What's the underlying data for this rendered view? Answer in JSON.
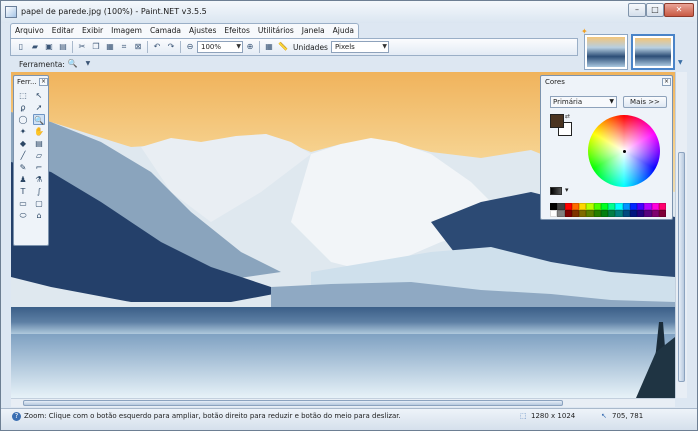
{
  "window": {
    "title": "papel de parede.jpg (100%) - Paint.NET v3.5.5"
  },
  "menu": {
    "items": [
      "Arquivo",
      "Editar",
      "Exibir",
      "Imagem",
      "Camada",
      "Ajustes",
      "Efeitos",
      "Utilitários",
      "Janela",
      "Ajuda"
    ]
  },
  "toolbar": {
    "zoom_value": "100%",
    "units_label": "Unidades",
    "units_value": "Pixels",
    "tool_label": "Ferramenta:"
  },
  "tools_panel": {
    "title": "Ferr...",
    "close": "×",
    "tools": [
      {
        "name": "rectangle-select-icon",
        "glyph": "⬚"
      },
      {
        "name": "move-selection-icon",
        "glyph": "↖"
      },
      {
        "name": "lasso-select-icon",
        "glyph": "ϼ"
      },
      {
        "name": "move-selected-icon",
        "glyph": "➚"
      },
      {
        "name": "ellipse-select-icon",
        "glyph": "◯"
      },
      {
        "name": "zoom-icon",
        "glyph": "🔍",
        "active": true
      },
      {
        "name": "magic-wand-icon",
        "glyph": "✦"
      },
      {
        "name": "pan-icon",
        "glyph": "✋"
      },
      {
        "name": "paint-bucket-icon",
        "glyph": "◆"
      },
      {
        "name": "gradient-icon",
        "glyph": "▤"
      },
      {
        "name": "paintbrush-icon",
        "glyph": "╱"
      },
      {
        "name": "eraser-icon",
        "glyph": "▱"
      },
      {
        "name": "pencil-icon",
        "glyph": "✎"
      },
      {
        "name": "color-picker-icon",
        "glyph": "⌐"
      },
      {
        "name": "clone-stamp-icon",
        "glyph": "♟"
      },
      {
        "name": "recolor-icon",
        "glyph": "⚗"
      },
      {
        "name": "text-icon",
        "glyph": "T"
      },
      {
        "name": "line-curve-icon",
        "glyph": "∫"
      },
      {
        "name": "rectangle-icon",
        "glyph": "▭"
      },
      {
        "name": "rounded-rectangle-icon",
        "glyph": "▢"
      },
      {
        "name": "ellipse-icon",
        "glyph": "⬭"
      },
      {
        "name": "freeform-shape-icon",
        "glyph": "⌂"
      }
    ]
  },
  "colors_panel": {
    "title": "Cores",
    "close": "×",
    "mode_value": "Primária",
    "more_label": "Mais >>",
    "primary_color": "#4b3421",
    "secondary_color": "#ffffff",
    "palette_top": [
      "#000000",
      "#404040",
      "#ff0000",
      "#ff6a00",
      "#ffd800",
      "#b6ff00",
      "#4cff00",
      "#00ff21",
      "#00ff90",
      "#00ffff",
      "#0094ff",
      "#0026ff",
      "#4800ff",
      "#b200ff",
      "#ff00dc",
      "#ff006e"
    ],
    "palette_bottom": [
      "#ffffff",
      "#808080",
      "#7f0000",
      "#7f3300",
      "#7f6a00",
      "#5b7f00",
      "#267f00",
      "#007f0e",
      "#007f46",
      "#007f7f",
      "#004a7f",
      "#00137f",
      "#21007f",
      "#57007f",
      "#7f006e",
      "#7f0037"
    ]
  },
  "status": {
    "help_text": "Zoom: Clique com o botão esquerdo para ampliar, botão direito para reduzir e botão do meio para deslizar.",
    "image_size": "1280 x 1024",
    "cursor_position": "705, 781"
  },
  "colors": {
    "accent": "#3b6fb3",
    "chrome": "#dde7f2"
  }
}
